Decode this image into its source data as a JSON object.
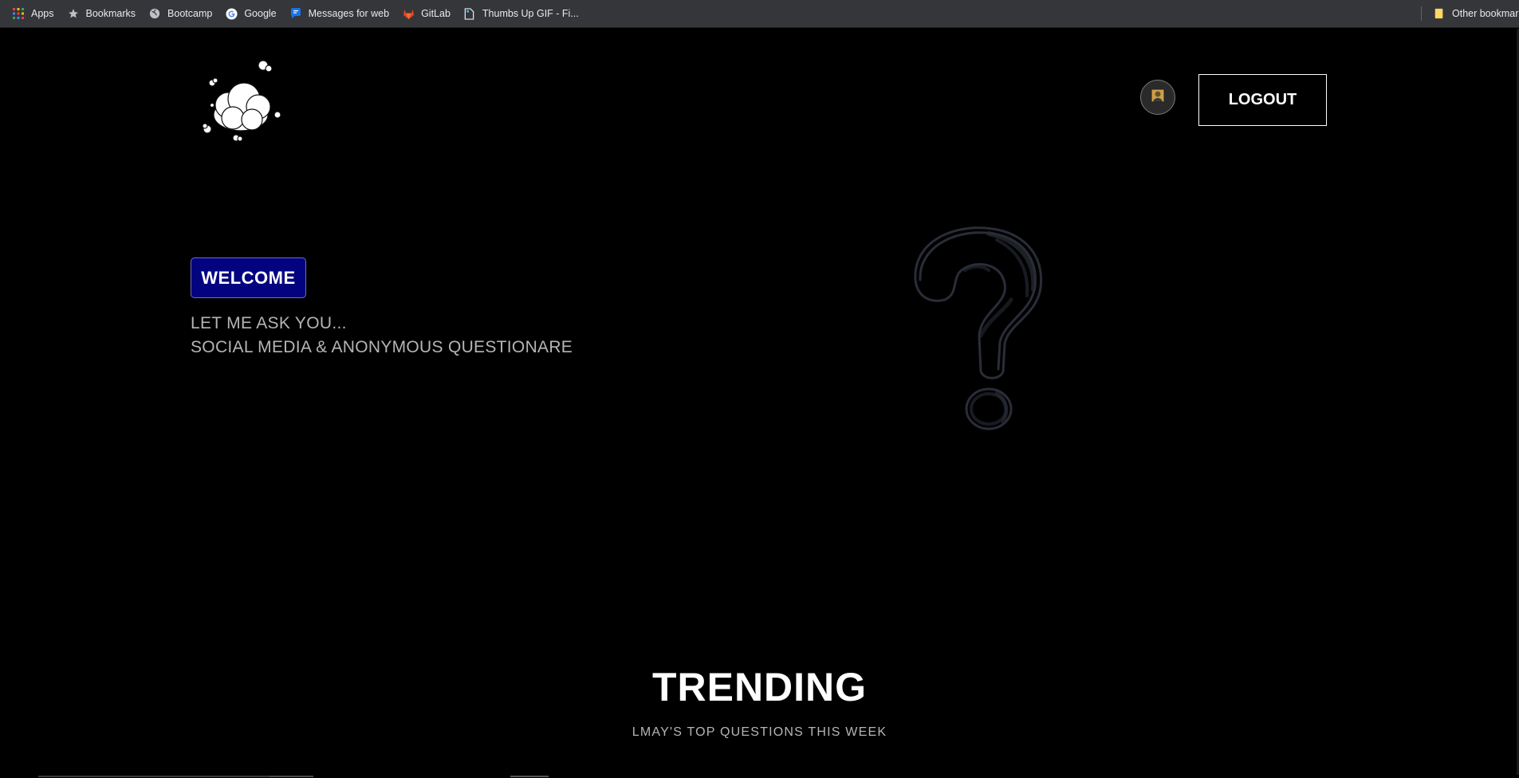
{
  "bookmarks": {
    "items": [
      {
        "label": "Apps",
        "icon": "apps-grid-icon"
      },
      {
        "label": "Bookmarks",
        "icon": "star-icon"
      },
      {
        "label": "Bootcamp",
        "icon": "globe-icon"
      },
      {
        "label": "Google",
        "icon": "google-icon"
      },
      {
        "label": "Messages for web",
        "icon": "messages-icon"
      },
      {
        "label": "GitLab",
        "icon": "gitlab-icon"
      },
      {
        "label": "Thumbs Up GIF - Fi...",
        "icon": "file-icon"
      }
    ],
    "other": {
      "label": "Other bookmarks",
      "icon": "folder-icon"
    }
  },
  "header": {
    "logo": "cloud-logo-icon",
    "avatar": "user-avatar-icon",
    "logout_label": "LOGOUT"
  },
  "hero": {
    "welcome_label": "WELCOME",
    "line1": "LET ME ASK YOU...",
    "line2": "SOCIAL MEDIA & ANONYMOUS QUESTIONARE",
    "illustration": "question-mark-icon"
  },
  "trending": {
    "title": "TRENDING",
    "subtitle": "LMAY'S TOP QUESTIONS THIS WEEK"
  },
  "colors": {
    "background": "#000000",
    "welcome_bg": "#03037f",
    "text_muted": "#b5b5b5",
    "bookmarks_bar": "#35363a"
  }
}
